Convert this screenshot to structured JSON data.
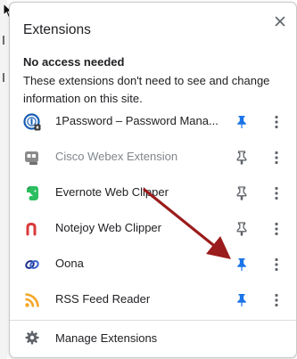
{
  "popup": {
    "title": "Extensions",
    "close_icon": "close-icon"
  },
  "section": {
    "heading": "No access needed",
    "description": "These extensions don't need to see and change information on this site."
  },
  "extensions": [
    {
      "name": "1Password – Password Mana...",
      "icon": "1password-icon",
      "pinned": true,
      "enabled": true
    },
    {
      "name": "Cisco Webex Extension",
      "icon": "cisco-webex-icon",
      "pinned": false,
      "enabled": false
    },
    {
      "name": "Evernote Web Clipper",
      "icon": "evernote-icon",
      "pinned": false,
      "enabled": true
    },
    {
      "name": "Notejoy Web Clipper",
      "icon": "notejoy-icon",
      "pinned": false,
      "enabled": true
    },
    {
      "name": "Oona",
      "icon": "oona-icon",
      "pinned": true,
      "enabled": true
    },
    {
      "name": "RSS Feed Reader",
      "icon": "rss-icon",
      "pinned": true,
      "enabled": true
    }
  ],
  "footer": {
    "manage_label": "Manage Extensions",
    "manage_icon": "gear-icon"
  },
  "colors": {
    "pinned": "#1a73e8",
    "unpinned": "#5f6368",
    "annotation_arrow": "#9b1c1c"
  }
}
